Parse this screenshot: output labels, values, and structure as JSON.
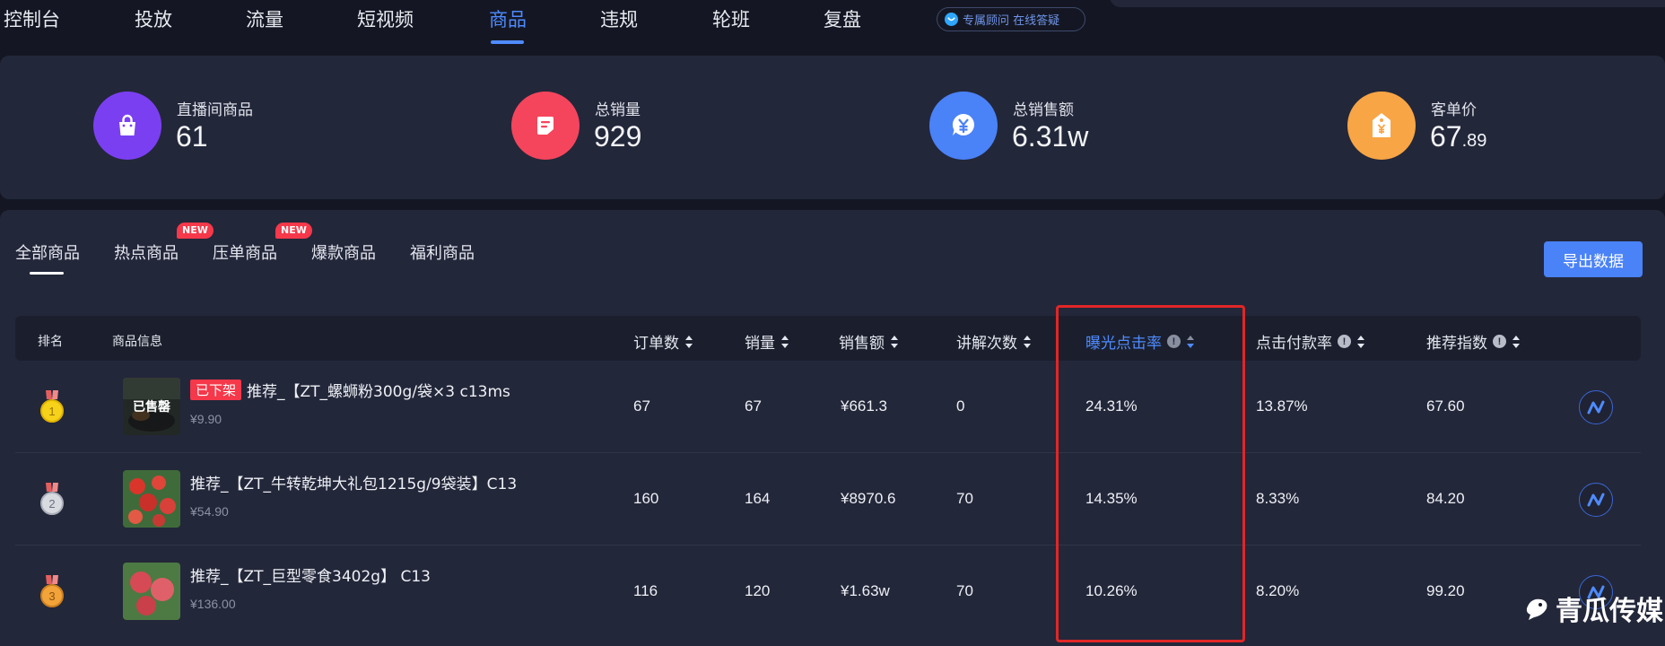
{
  "nav": {
    "items": [
      {
        "label": "控制台",
        "active": false
      },
      {
        "label": "投放",
        "active": false
      },
      {
        "label": "流量",
        "active": false
      },
      {
        "label": "短视频",
        "active": false
      },
      {
        "label": "商品",
        "active": true
      },
      {
        "label": "违规",
        "active": false
      },
      {
        "label": "轮班",
        "active": false
      },
      {
        "label": "复盘",
        "active": false
      }
    ],
    "consult_label": "专属顾问 在线答疑"
  },
  "stats": [
    {
      "label": "直播间商品",
      "value": "61",
      "value_small": "",
      "icon": "shopping-bag-icon",
      "color": "#7b3ff2"
    },
    {
      "label": "总销量",
      "value": "929",
      "value_small": "",
      "icon": "document-icon",
      "color": "#f5455c"
    },
    {
      "label": "总销售额",
      "value": "6.31w",
      "value_small": "",
      "icon": "yen-icon",
      "color": "#4a82f7"
    },
    {
      "label": "客单价",
      "value": "67",
      "value_small": ".89",
      "icon": "price-tag-icon",
      "color": "#f8a545"
    }
  ],
  "tabs": [
    {
      "label": "全部商品",
      "active": true,
      "badge": ""
    },
    {
      "label": "热点商品",
      "active": false,
      "badge": "NEW"
    },
    {
      "label": "压单商品",
      "active": false,
      "badge": "NEW"
    },
    {
      "label": "爆款商品",
      "active": false,
      "badge": ""
    },
    {
      "label": "福利商品",
      "active": false,
      "badge": ""
    }
  ],
  "export_label": "导出数据",
  "table": {
    "headers": {
      "rank": "排名",
      "product": "商品信息",
      "orders": "订单数",
      "sales": "销量",
      "revenue": "销售额",
      "explain": "讲解次数",
      "ctr": "曝光点击率",
      "cvr": "点击付款率",
      "score": "推荐指数"
    },
    "rows": [
      {
        "rank": "1",
        "off_shelf": "已下架",
        "sold_out": "已售罄",
        "name": "推荐_【ZT_螺蛳粉300g/袋×3 c13ms",
        "price": "¥9.90",
        "orders": "67",
        "sales": "67",
        "revenue": "¥661.3",
        "explain": "0",
        "ctr": "24.31%",
        "cvr": "13.87%",
        "score": "67.60"
      },
      {
        "rank": "2",
        "off_shelf": "",
        "sold_out": "",
        "name": "推荐_【ZT_牛转乾坤大礼包1215g/9袋装】C13",
        "price": "¥54.90",
        "orders": "160",
        "sales": "164",
        "revenue": "¥8970.6",
        "explain": "70",
        "ctr": "14.35%",
        "cvr": "8.33%",
        "score": "84.20"
      },
      {
        "rank": "3",
        "off_shelf": "",
        "sold_out": "",
        "name": "推荐_【ZT_巨型零食3402g】 C13",
        "price": "¥136.00",
        "orders": "116",
        "sales": "120",
        "revenue": "¥1.63w",
        "explain": "70",
        "ctr": "10.26%",
        "cvr": "8.20%",
        "score": "99.20"
      }
    ]
  },
  "watermark": "青瓜传媒",
  "colors": {
    "accent": "#4f8bff",
    "highlight": "#e12626",
    "badge": "#f5384a"
  }
}
